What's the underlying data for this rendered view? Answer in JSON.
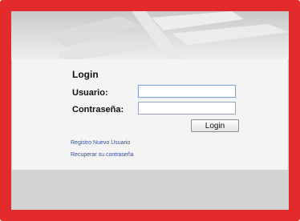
{
  "colors": {
    "frame": "#e32b2b",
    "panel": "#f4f4f4",
    "footer_band": "#d3d3d3",
    "link": "#2f4fa0"
  },
  "login": {
    "title": "Login",
    "username_label": "Usuario:",
    "username_value": "",
    "password_label": "Contraseña:",
    "password_value": "",
    "submit_label": "Login"
  },
  "links": {
    "register": "Registro Nuevo Usuario",
    "recover": "Recuperar su contraseña"
  }
}
